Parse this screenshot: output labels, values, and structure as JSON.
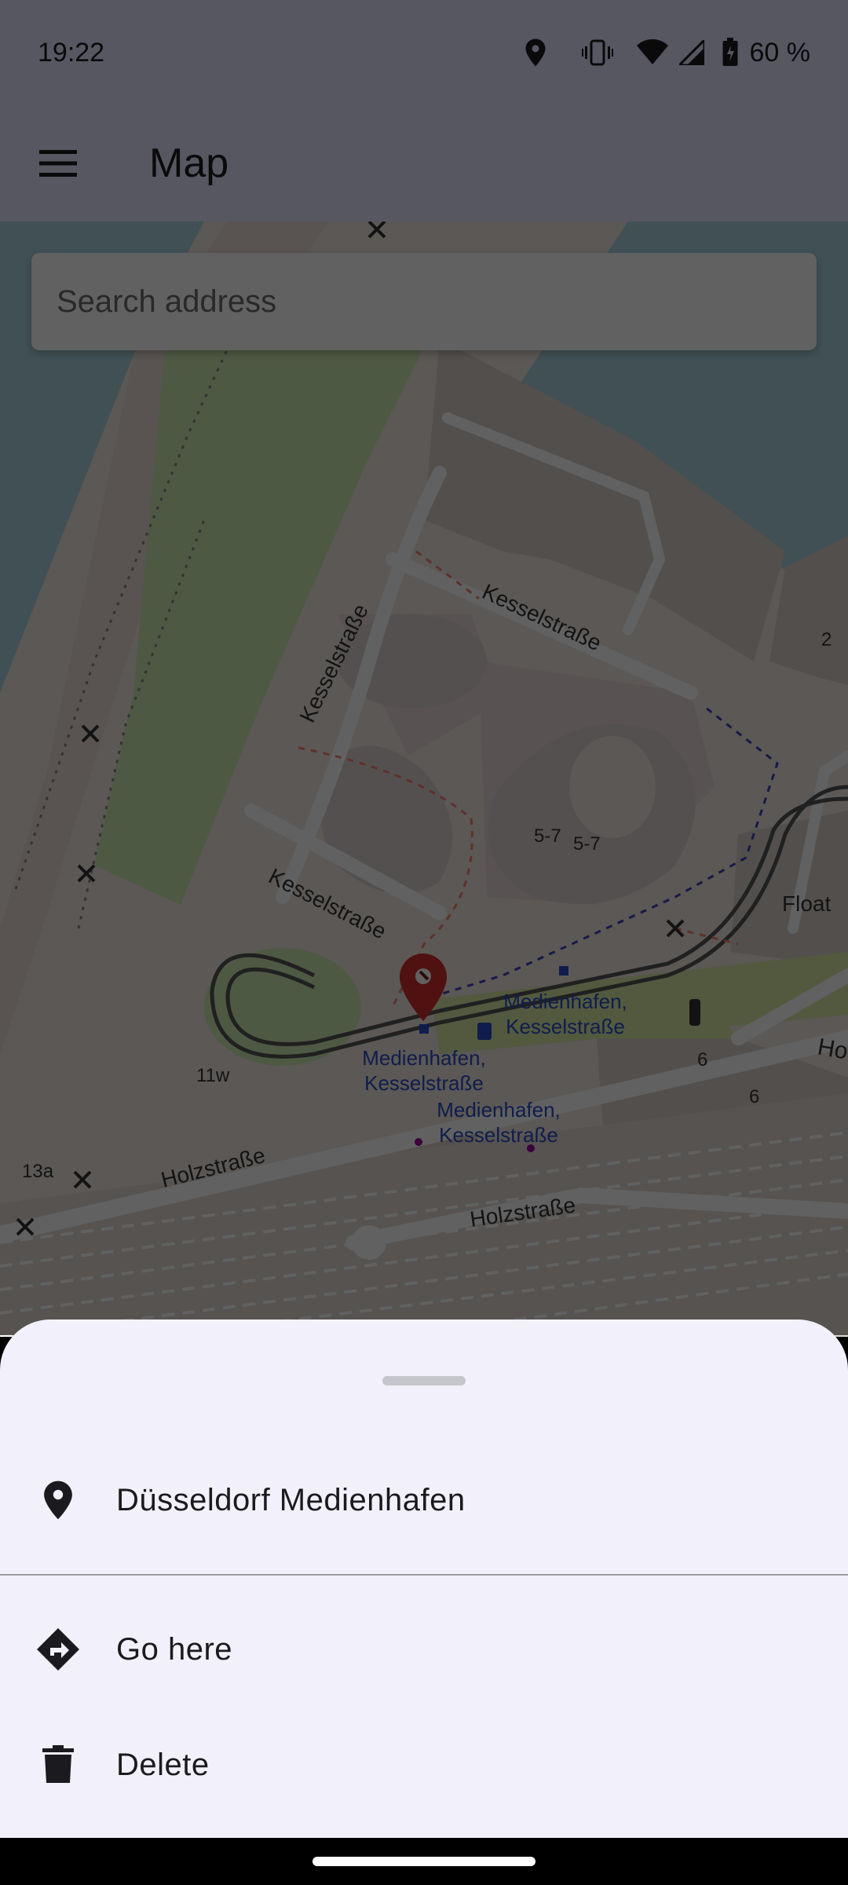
{
  "status_bar": {
    "time": "19:22",
    "battery": "60 %",
    "icons": [
      "location-icon",
      "vibrate-icon",
      "wifi-icon",
      "signal-icon",
      "battery-icon"
    ]
  },
  "app_bar": {
    "title": "Map",
    "menu_icon": "menu-icon"
  },
  "search": {
    "placeholder": "Search address"
  },
  "map": {
    "labels": {
      "street_1": "Kesselstraße",
      "street_2": "Kesselstraße",
      "street_3": "Kesselstraße",
      "street_4": "Holzstraße",
      "street_5": "Holzstraße",
      "stop_1": "Medienhafen,",
      "stop_1b": "Kesselstraße",
      "stop_2": "Medienhafen,",
      "stop_2b": "Kesselstraße",
      "stop_3": "Medienhafen,",
      "stop_3b": "Kesselstraße",
      "num_57a": "5-7",
      "num_57b": "5-7",
      "num_2": "2",
      "num_6a": "6",
      "num_6b": "6",
      "num_11w": "11w",
      "num_13a": "13a",
      "float": "Float",
      "ho": "Ho"
    }
  },
  "bottom_sheet": {
    "place_name": "Düsseldorf Medienhafen",
    "actions": {
      "go_here": "Go here",
      "delete": "Delete"
    }
  },
  "colors": {
    "app_bar_bg": "#e1e5ff",
    "sheet_bg": "#f2f1fb",
    "pin_red": "#d32f2f"
  }
}
